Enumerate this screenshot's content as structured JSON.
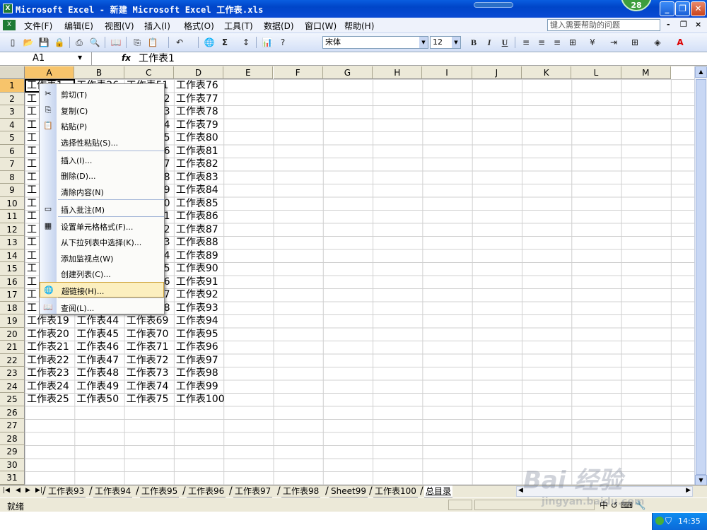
{
  "window": {
    "title": "Microsoft Excel - 新建 Microsoft Excel 工作表.xls",
    "badge": "28",
    "min_glyph": "_",
    "restore_glyph": "❐",
    "close_glyph": "✕"
  },
  "menubar": {
    "items": [
      "文件(F)",
      "编辑(E)",
      "视图(V)",
      "插入(I)",
      "格式(O)",
      "工具(T)",
      "数据(D)",
      "窗口(W)",
      "帮助(H)"
    ],
    "help_placeholder": "键入需要帮助的问题",
    "mdi_min": "-",
    "mdi_restore": "❐",
    "mdi_close": "×"
  },
  "toolbar": {
    "icons": [
      "new-icon",
      "open-icon",
      "save-icon",
      "permission-icon",
      "print-icon",
      "print-preview-icon",
      "research-icon",
      "copy-icon",
      "paste-icon",
      "undo-icon",
      "hyperlink-icon",
      "autosum-icon",
      "sort-icon",
      "chart-icon",
      "help-icon"
    ],
    "font": "宋体",
    "font_size": "12",
    "bold": "B",
    "italic": "I",
    "underline": "U"
  },
  "formula": {
    "name_box": "A1",
    "fx": "fx",
    "value": "工作表1"
  },
  "columns": [
    "A",
    "B",
    "C",
    "D",
    "E",
    "F",
    "G",
    "H",
    "I",
    "J",
    "K",
    "L",
    "M"
  ],
  "rows": [
    "1",
    "2",
    "3",
    "4",
    "5",
    "6",
    "7",
    "8",
    "9",
    "10",
    "11",
    "12",
    "13",
    "14",
    "15",
    "16",
    "17",
    "18",
    "19",
    "20",
    "21",
    "22",
    "23",
    "24",
    "25",
    "26",
    "27",
    "28",
    "29",
    "30",
    "31"
  ],
  "cells_visible": {
    "A1": "工作表1",
    "B1": "工作表26",
    "C1": "工作表51",
    "D": [
      "工作表76",
      "工作表77",
      "工作表78",
      "工作表79",
      "工作表80",
      "工作表81",
      "工作表82",
      "工作表83",
      "工作表84",
      "工作表85",
      "工作表86",
      "工作表87",
      "工作表88",
      "工作表89",
      "工作表90",
      "工作表91",
      "工作表92",
      "工作表93",
      "工作表94",
      "工作表95",
      "工作表96",
      "工作表97",
      "工作表98",
      "工作表99",
      "工作表100"
    ],
    "A_from19": [
      "工作表19",
      "工作表20",
      "工作表21",
      "工作表22",
      "工作表23",
      "工作表24",
      "工作表25"
    ],
    "B_from19": [
      "工作表44",
      "工作表45",
      "工作表46",
      "工作表47",
      "工作表48",
      "工作表49",
      "工作表50"
    ],
    "C_from19": [
      "工作表69",
      "工作表70",
      "工作表71",
      "工作表72",
      "工作表73",
      "工作表74",
      "工作表75"
    ],
    "C_partial": [
      "2",
      "3",
      "4",
      "5",
      "6",
      "7",
      "8",
      "9",
      "0",
      "1",
      "2",
      "3",
      "4",
      "5",
      "6",
      "7",
      "8"
    ],
    "A_partial": "工"
  },
  "context_menu": {
    "items": [
      {
        "label": "剪切(T)",
        "icon": "cut-icon",
        "glyph": "✂"
      },
      {
        "label": "复制(C)",
        "icon": "copy-icon",
        "glyph": "⎘"
      },
      {
        "label": "粘贴(P)",
        "icon": "paste-icon",
        "glyph": "📋"
      },
      {
        "label": "选择性粘贴(S)...",
        "icon": "",
        "glyph": ""
      },
      {
        "label": "插入(I)...",
        "icon": "",
        "glyph": ""
      },
      {
        "label": "删除(D)...",
        "icon": "",
        "glyph": ""
      },
      {
        "label": "清除内容(N)",
        "icon": "",
        "glyph": ""
      },
      {
        "label": "插入批注(M)",
        "icon": "comment-icon",
        "glyph": "▭"
      },
      {
        "label": "设置单元格格式(F)...",
        "icon": "format-cells-icon",
        "glyph": "▦"
      },
      {
        "label": "从下拉列表中选择(K)...",
        "icon": "",
        "glyph": ""
      },
      {
        "label": "添加监视点(W)",
        "icon": "",
        "glyph": ""
      },
      {
        "label": "创建列表(C)...",
        "icon": "",
        "glyph": ""
      },
      {
        "label": "超链接(H)...",
        "icon": "hyperlink-icon",
        "glyph": "🌐"
      },
      {
        "label": "查阅(L)...",
        "icon": "research-icon",
        "glyph": "📖"
      }
    ],
    "highlighted_index": 12
  },
  "sheet_tabs": [
    "工作表93",
    "工作表94",
    "工作表95",
    "工作表96",
    "工作表97",
    "工作表98",
    "Sheet99",
    "工作表100",
    "总目录"
  ],
  "active_tab": "总目录",
  "status": {
    "text": "就绪",
    "ime": "中"
  },
  "taskbar": {
    "clock": "14:35"
  },
  "watermark": {
    "logo": "Bai 经验",
    "sub": "jingyan.baidu.com"
  },
  "colors": {
    "title_blue": "#0a5de0",
    "highlight": "#fcefbf"
  }
}
